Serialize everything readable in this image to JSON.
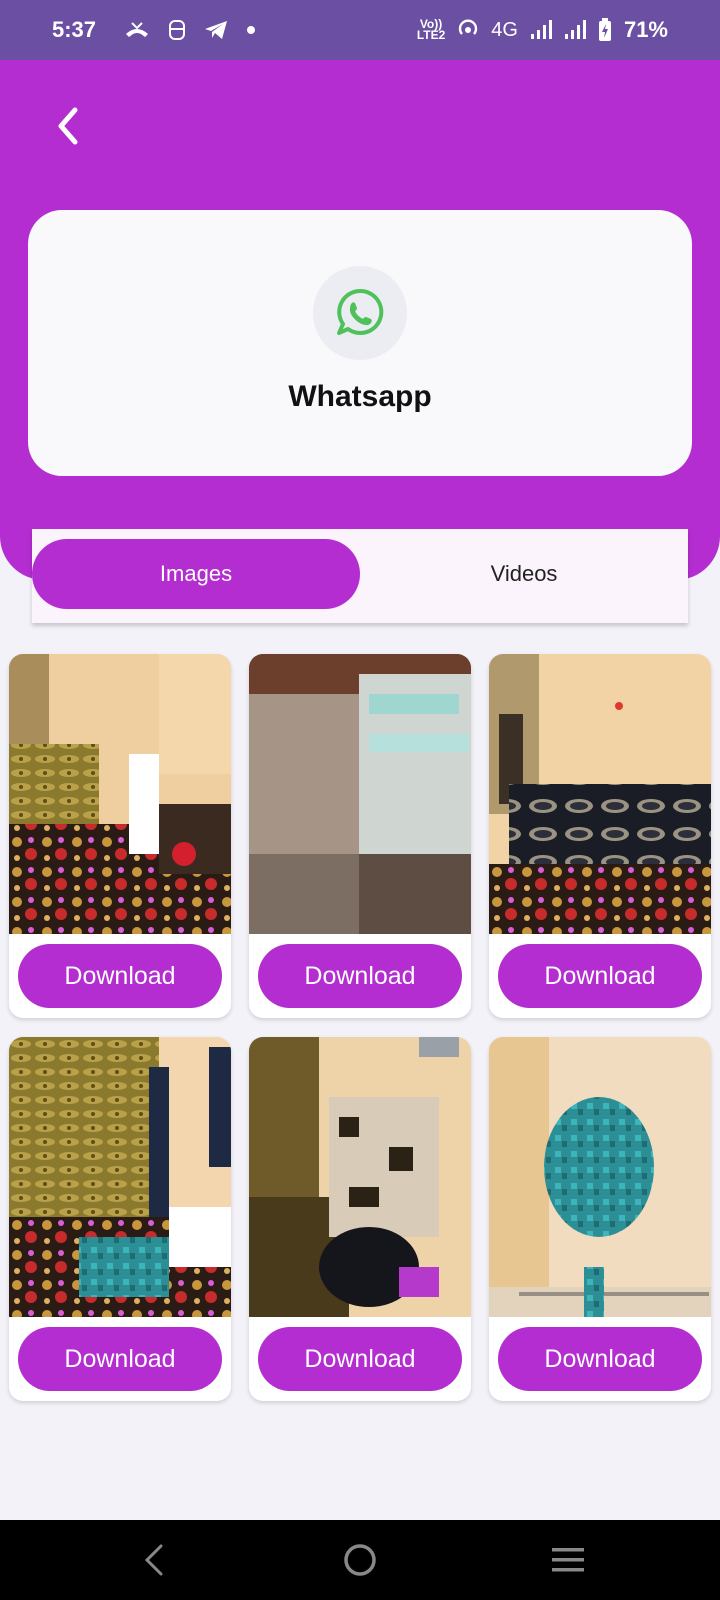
{
  "status_bar": {
    "time": "5:37",
    "network_label_top": "Vo))",
    "network_label_bottom": "LTE2",
    "network_type": "4G",
    "battery": "71%"
  },
  "header": {
    "back_icon": "chevron-left-icon"
  },
  "app_card": {
    "icon": "whatsapp-icon",
    "icon_color": "#4fc15b",
    "title": "Whatsapp"
  },
  "tabs": [
    {
      "label": "Images",
      "selected": true
    },
    {
      "label": "Videos",
      "selected": false
    }
  ],
  "media_items": [
    {
      "type": "image",
      "button_label": "Download"
    },
    {
      "type": "image",
      "button_label": "Download"
    },
    {
      "type": "image",
      "button_label": "Download"
    },
    {
      "type": "image",
      "button_label": "Download"
    },
    {
      "type": "image",
      "button_label": "Download"
    },
    {
      "type": "image",
      "button_label": "Download"
    }
  ],
  "nav": {
    "back": "nav-back-icon",
    "home": "nav-home-icon",
    "recents": "nav-recents-icon"
  },
  "colors": {
    "accent": "#b42dd0",
    "status_bar": "#6a4fa3"
  }
}
